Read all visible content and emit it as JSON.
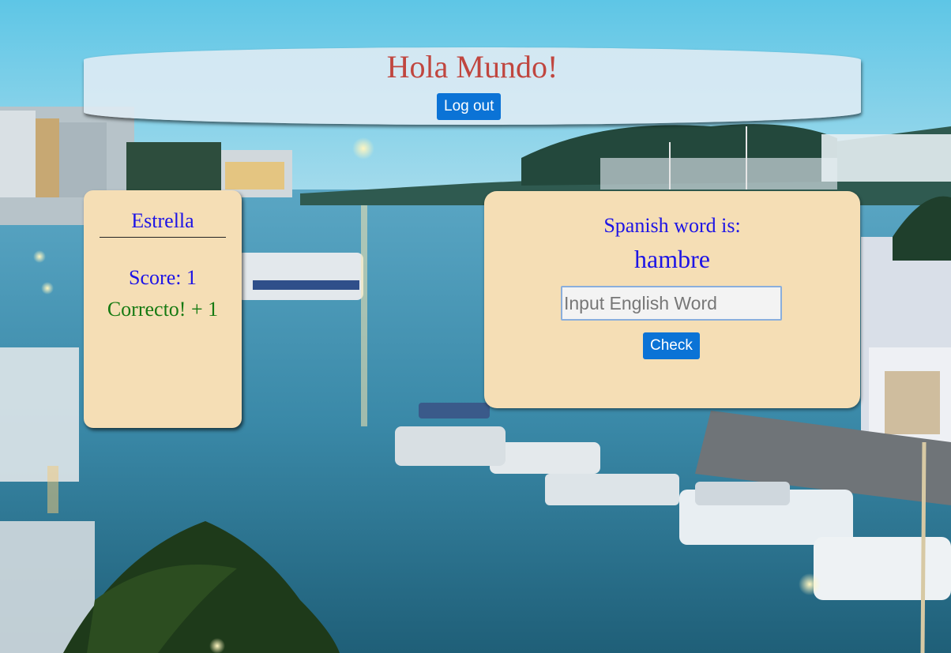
{
  "header": {
    "title": "Hola Mundo!",
    "logout_label": "Log out"
  },
  "player": {
    "name": "Estrella",
    "score_text": "Score: 1",
    "feedback_text": "Correcto! + 1"
  },
  "quiz": {
    "prompt": "Spanish word is:",
    "spanish_word": "hambre",
    "answer_placeholder": "Input English Word",
    "answer_value": "",
    "check_label": "Check"
  },
  "colors": {
    "title": "#c0463f",
    "button": "#0b73d6",
    "panel": "#f5deb5",
    "text_blue": "#1d14e6",
    "text_green": "#167a12"
  }
}
